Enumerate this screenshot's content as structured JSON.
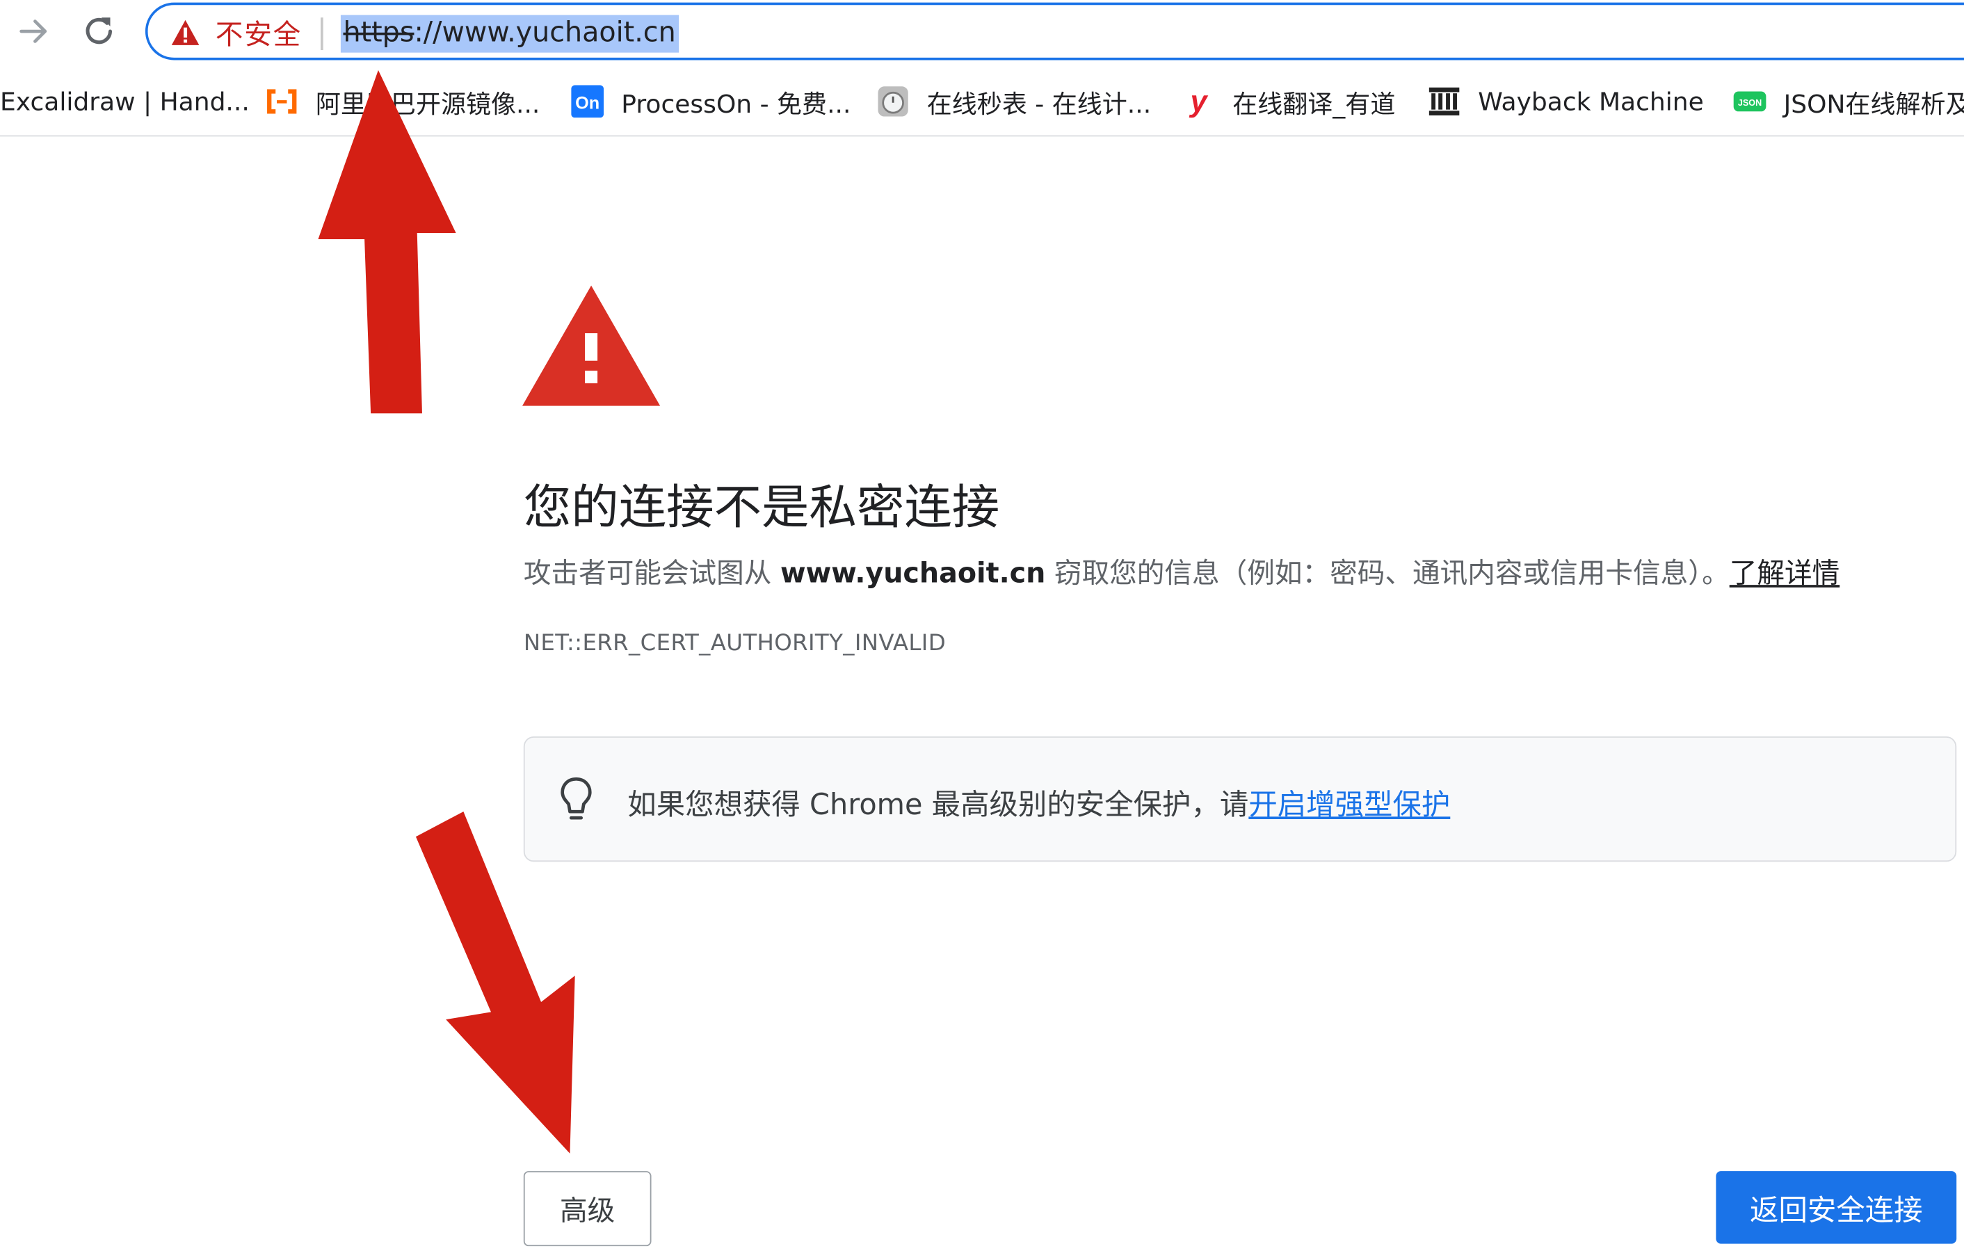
{
  "toolbar": {
    "security_label": "不安全",
    "url_scheme": "https",
    "url_rest": "://www.yuchaoit.cn",
    "icons": {
      "forward": "forward-arrow-icon",
      "reload": "reload-icon",
      "security": "warning-triangle-icon"
    }
  },
  "bookmarks": [
    {
      "label": "Excalidraw | Hand...",
      "icon": "none"
    },
    {
      "label": "阿里巴巴开源镜像...",
      "icon": "aliyun-icon",
      "color": "#ff6a00"
    },
    {
      "label": "ProcessOn - 免费...",
      "icon": "processon-icon",
      "color": "#1677ff"
    },
    {
      "label": "在线秒表 - 在线计...",
      "icon": "stopwatch-icon",
      "color": "#9e9e9e"
    },
    {
      "label": "在线翻译_有道",
      "icon": "youdao-icon",
      "color": "#e5202e"
    },
    {
      "label": "Wayback Machine",
      "icon": "wayback-icon",
      "color": "#222222"
    },
    {
      "label": "JSON在线解析及",
      "icon": "json-icon",
      "color": "#1ec45e"
    }
  ],
  "page": {
    "headline": "您的连接不是私密连接",
    "explanation_pre": "攻击者可能会试图从 ",
    "explanation_domain": "www.yuchaoit.cn",
    "explanation_post": " 窃取您的信息（例如：密码、通讯内容或信用卡信息）。",
    "learn_more": "了解详情",
    "error_code": "NET::ERR_CERT_AUTHORITY_INVALID",
    "enhanced_text": "如果您想获得 Chrome 最高级别的安全保护，请",
    "enhanced_link": "开启增强型保护",
    "advanced_button": "高级",
    "back_button": "返回安全连接"
  },
  "colors": {
    "accent": "#1a73e8",
    "warning_red": "#d93025",
    "annotation_arrow": "#d41f14"
  }
}
